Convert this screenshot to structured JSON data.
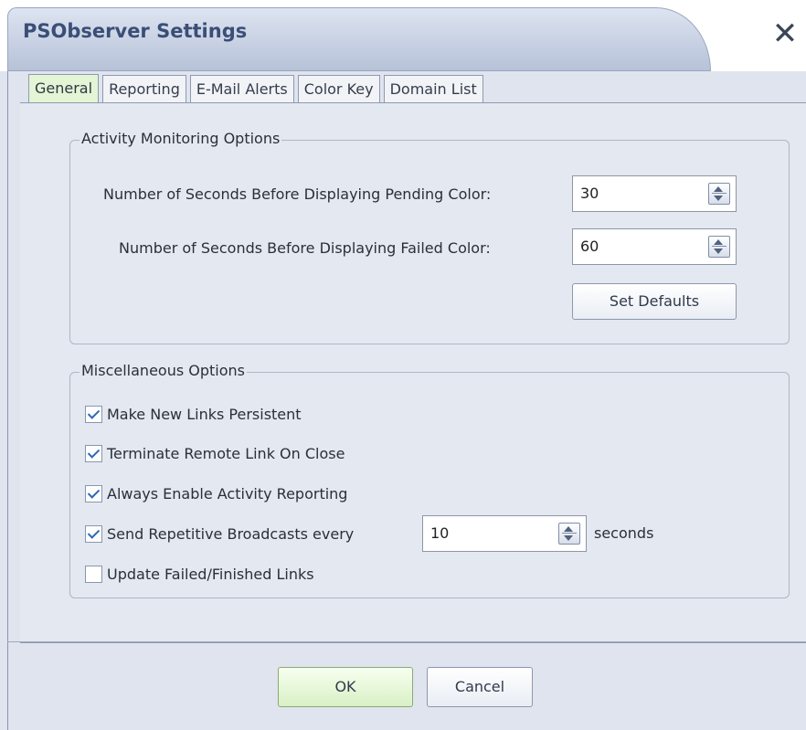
{
  "window": {
    "title": "PSObserver Settings",
    "close_label": "✕"
  },
  "tabs": [
    {
      "label": "General",
      "active": true
    },
    {
      "label": "Reporting",
      "active": false
    },
    {
      "label": "E-Mail Alerts",
      "active": false
    },
    {
      "label": "Color Key",
      "active": false
    },
    {
      "label": "Domain List",
      "active": false
    }
  ],
  "activity": {
    "title": "Activity Monitoring Options",
    "pending_label": "Number of Seconds Before Displaying Pending Color:",
    "pending_value": "30",
    "failed_label": "Number of Seconds Before Displaying Failed Color:",
    "failed_value": "60",
    "set_defaults_label": "Set Defaults"
  },
  "misc": {
    "title": "Miscellaneous Options",
    "options": [
      {
        "label": "Make New Links Persistent",
        "checked": true
      },
      {
        "label": "Terminate Remote Link On Close",
        "checked": true
      },
      {
        "label": "Always Enable Activity Reporting",
        "checked": true
      },
      {
        "label": "Send Repetitive Broadcasts every",
        "checked": true
      },
      {
        "label": "Update Failed/Finished Links",
        "checked": false
      }
    ],
    "broadcast_value": "10",
    "broadcast_unit": "seconds"
  },
  "buttons": {
    "ok": "OK",
    "cancel": "Cancel"
  },
  "colors": {
    "accent": "#3a4e77",
    "active_tab": "#e4f5d6",
    "ok_button": "#d9f0c6"
  }
}
